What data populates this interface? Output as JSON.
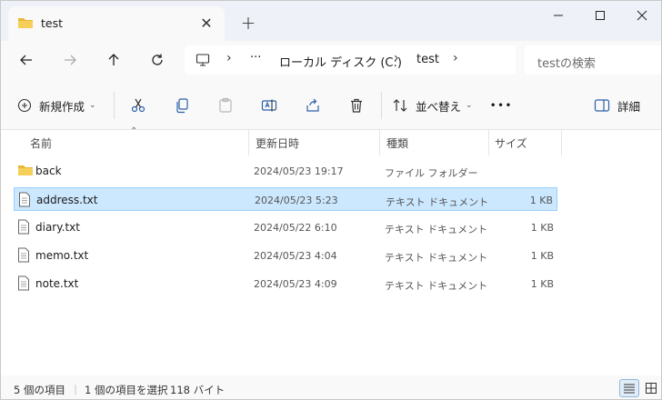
{
  "tab": {
    "title": "test",
    "close_glyph": "✕",
    "new_glyph": "+"
  },
  "window_controls": {
    "minimize": "—",
    "maximize": "☐",
    "close": "✕"
  },
  "address_bar": {
    "ellipsis": "···",
    "separator": "›",
    "segments": [
      "ローカル ディスク (C:)",
      "test"
    ]
  },
  "search": {
    "placeholder": "testの検索"
  },
  "command_bar": {
    "new_label": "新規作成",
    "sort_label": "並べ替え",
    "more_label": "•••",
    "details_label": "詳細",
    "chevron": "⌄"
  },
  "columns": [
    "名前",
    "更新日時",
    "種類",
    "サイズ"
  ],
  "sort_indicator": "⌃",
  "files": [
    {
      "name": "back",
      "date": "2024/05/23 19:17",
      "type": "ファイル フォルダー",
      "size": "",
      "icon": "folder-icon"
    },
    {
      "name": "address.txt",
      "date": "2024/05/23 5:23",
      "type": "テキスト ドキュメント",
      "size": "1 KB",
      "icon": "text-file-icon",
      "selected": true
    },
    {
      "name": "diary.txt",
      "date": "2024/05/22 6:10",
      "type": "テキスト ドキュメント",
      "size": "1 KB",
      "icon": "text-file-icon"
    },
    {
      "name": "memo.txt",
      "date": "2024/05/23 4:04",
      "type": "テキスト ドキュメント",
      "size": "1 KB",
      "icon": "text-file-icon"
    },
    {
      "name": "note.txt",
      "date": "2024/05/23 4:09",
      "type": "テキスト ドキュメント",
      "size": "1 KB",
      "icon": "text-file-icon"
    }
  ],
  "status": {
    "item_count": "5 個の項目",
    "selection": "1 個の項目を選択",
    "selection_size": "118 バイト"
  },
  "colors": {
    "selected_bg": "#cce8ff",
    "selected_border": "#99d1ff",
    "folder": "#f2c94c"
  }
}
